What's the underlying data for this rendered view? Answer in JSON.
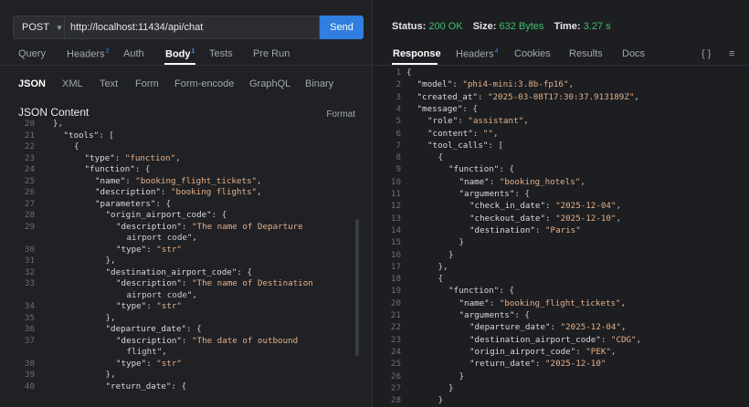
{
  "request": {
    "method": "POST",
    "url": "http://localhost:11434/api/chat",
    "send_label": "Send"
  },
  "request_tabs": [
    {
      "label": "Query",
      "badge": "",
      "active": false
    },
    {
      "label": "Headers",
      "badge": "2",
      "active": false
    },
    {
      "label": "Auth",
      "badge": "",
      "active": false
    },
    {
      "label": "Body",
      "badge": "1",
      "active": true
    },
    {
      "label": "Tests",
      "badge": "",
      "active": false
    },
    {
      "label": "Pre Run",
      "badge": "",
      "active": false
    }
  ],
  "body_tabs": [
    {
      "label": "JSON",
      "active": true
    },
    {
      "label": "XML",
      "active": false
    },
    {
      "label": "Text",
      "active": false
    },
    {
      "label": "Form",
      "active": false
    },
    {
      "label": "Form-encode",
      "active": false
    },
    {
      "label": "GraphQL",
      "active": false
    },
    {
      "label": "Binary",
      "active": false
    }
  ],
  "json_content_label": "JSON Content",
  "format_label": "Format",
  "request_code": [
    {
      "n": "20",
      "t": "},"
    },
    {
      "n": "21",
      "t": "\"tools\": [",
      "i": 1
    },
    {
      "n": "22",
      "t": "{",
      "i": 2
    },
    {
      "n": "23",
      "t": "\"type\": \"function\",",
      "i": 3
    },
    {
      "n": "24",
      "t": "\"function\": {",
      "i": 3
    },
    {
      "n": "25",
      "t": "\"name\": \"booking_flight_tickets\",",
      "i": 4
    },
    {
      "n": "26",
      "t": "\"description\": \"booking flights\",",
      "i": 4
    },
    {
      "n": "27",
      "t": "\"parameters\": {",
      "i": 4
    },
    {
      "n": "28",
      "t": "\"origin_airport_code\": {",
      "i": 5
    },
    {
      "n": "29",
      "t": "\"description\": \"The name of Departure",
      "i": 6
    },
    {
      "n": "",
      "t": "airport code\",",
      "i": 7
    },
    {
      "n": "30",
      "t": "\"type\": \"str\"",
      "i": 6
    },
    {
      "n": "31",
      "t": "},",
      "i": 5
    },
    {
      "n": "32",
      "t": "\"destination_airport_code\": {",
      "i": 5
    },
    {
      "n": "33",
      "t": "\"description\": \"The name of Destination",
      "i": 6
    },
    {
      "n": "",
      "t": "airport code\",",
      "i": 7
    },
    {
      "n": "34",
      "t": "\"type\": \"str\"",
      "i": 6
    },
    {
      "n": "35",
      "t": "},",
      "i": 5
    },
    {
      "n": "36",
      "t": "\"departure_date\": {",
      "i": 5
    },
    {
      "n": "37",
      "t": "\"description\": \"The date of outbound",
      "i": 6
    },
    {
      "n": "",
      "t": "flight\",",
      "i": 7
    },
    {
      "n": "38",
      "t": "\"type\": \"str\"",
      "i": 6
    },
    {
      "n": "39",
      "t": "},",
      "i": 5
    },
    {
      "n": "40",
      "t": "\"return_date\": {",
      "i": 5
    }
  ],
  "response_status": {
    "status_label": "Status:",
    "status_value": "200 OK",
    "size_label": "Size:",
    "size_value": "632 Bytes",
    "time_label": "Time:",
    "time_value": "3.27 s"
  },
  "response_tabs": [
    {
      "label": "Response",
      "badge": "",
      "active": true
    },
    {
      "label": "Headers",
      "badge": "4",
      "active": false
    },
    {
      "label": "Cookies",
      "badge": "",
      "active": false
    },
    {
      "label": "Results",
      "badge": "",
      "active": false
    },
    {
      "label": "Docs",
      "badge": "",
      "active": false
    }
  ],
  "response_icons": {
    "braces": "{ }",
    "menu": "≡"
  },
  "response_code": [
    {
      "n": "1",
      "t": "{",
      "i": 0
    },
    {
      "n": "2",
      "t": "\"model\": \"phi4-mini:3.8b-fp16\",",
      "i": 1
    },
    {
      "n": "3",
      "t": "\"created_at\": \"2025-03-08T17:30:37.913189Z\",",
      "i": 1
    },
    {
      "n": "4",
      "t": "\"message\": {",
      "i": 1
    },
    {
      "n": "5",
      "t": "\"role\": \"assistant\",",
      "i": 2
    },
    {
      "n": "6",
      "t": "\"content\": \"\",",
      "i": 2
    },
    {
      "n": "7",
      "t": "\"tool_calls\": [",
      "i": 2
    },
    {
      "n": "8",
      "t": "{",
      "i": 3
    },
    {
      "n": "9",
      "t": "\"function\": {",
      "i": 4
    },
    {
      "n": "10",
      "t": "\"name\": \"booking_hotels\",",
      "i": 5
    },
    {
      "n": "11",
      "t": "\"arguments\": {",
      "i": 5
    },
    {
      "n": "12",
      "t": "\"check_in_date\": \"2025-12-04\",",
      "i": 6
    },
    {
      "n": "13",
      "t": "\"checkout_date\": \"2025-12-10\",",
      "i": 6
    },
    {
      "n": "14",
      "t": "\"destination\": \"Paris\"",
      "i": 6
    },
    {
      "n": "15",
      "t": "}",
      "i": 5
    },
    {
      "n": "16",
      "t": "}",
      "i": 4
    },
    {
      "n": "17",
      "t": "},",
      "i": 3
    },
    {
      "n": "18",
      "t": "{",
      "i": 3
    },
    {
      "n": "19",
      "t": "\"function\": {",
      "i": 4
    },
    {
      "n": "20",
      "t": "\"name\": \"booking_flight_tickets\",",
      "i": 5
    },
    {
      "n": "21",
      "t": "\"arguments\": {",
      "i": 5
    },
    {
      "n": "22",
      "t": "\"departure_date\": \"2025-12-04\",",
      "i": 6
    },
    {
      "n": "23",
      "t": "\"destination_airport_code\": \"CDG\",",
      "i": 6
    },
    {
      "n": "24",
      "t": "\"origin_airport_code\": \"PEK\",",
      "i": 6
    },
    {
      "n": "25",
      "t": "\"return_date\": \"2025-12-10\"",
      "i": 6
    },
    {
      "n": "26",
      "t": "}",
      "i": 5
    },
    {
      "n": "27",
      "t": "}",
      "i": 4
    },
    {
      "n": "28",
      "t": "}",
      "i": 3
    }
  ]
}
